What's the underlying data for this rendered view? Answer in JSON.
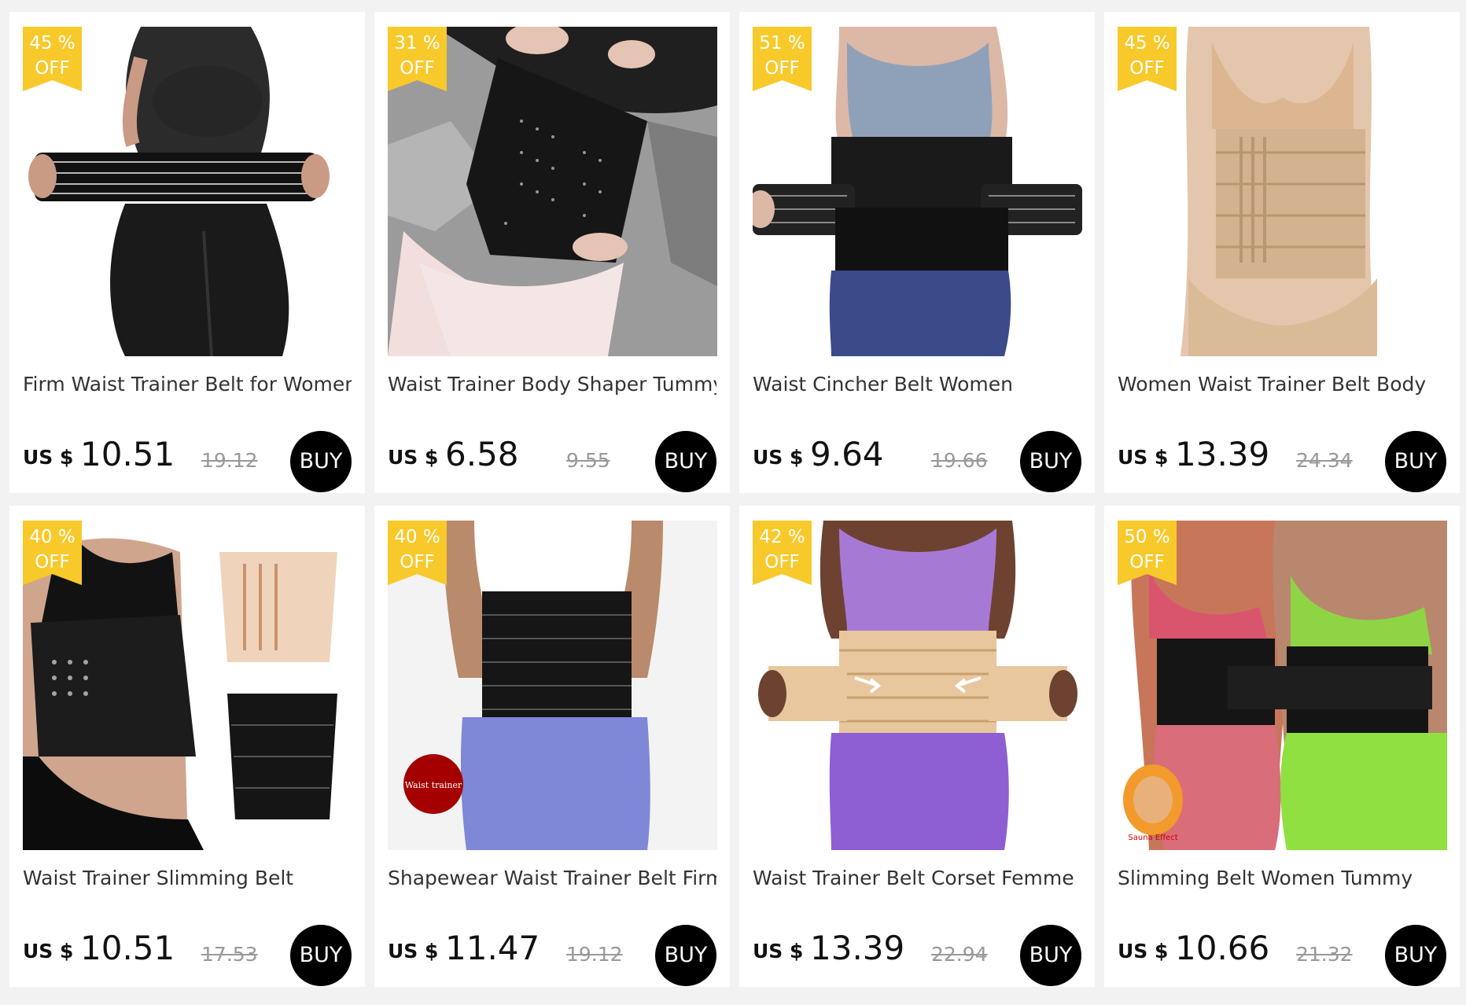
{
  "products": [
    {
      "discount": "45 %",
      "off": "OFF",
      "title": "Firm Waist Trainer Belt for Women",
      "currency": "US $",
      "price": "10.51",
      "old_price": "19.12",
      "buy": "BUY"
    },
    {
      "discount": "31 %",
      "off": "OFF",
      "title": "Waist Trainer Body Shaper Tummy",
      "currency": "US $",
      "price": "6.58",
      "old_price": "9.55",
      "buy": "BUY"
    },
    {
      "discount": "51 %",
      "off": "OFF",
      "title": "Waist Cincher Belt Women",
      "currency": "US $",
      "price": "9.64",
      "old_price": "19.66",
      "buy": "BUY"
    },
    {
      "discount": "45 %",
      "off": "OFF",
      "title": "Women Waist Trainer Belt Body",
      "currency": "US $",
      "price": "13.39",
      "old_price": "24.34",
      "buy": "BUY"
    },
    {
      "discount": "40 %",
      "off": "OFF",
      "title": "Waist Trainer Slimming Belt",
      "currency": "US $",
      "price": "10.51",
      "old_price": "17.53",
      "buy": "BUY"
    },
    {
      "discount": "40 %",
      "off": "OFF",
      "title": "Shapewear Waist Trainer Belt Firm",
      "currency": "US $",
      "price": "11.47",
      "old_price": "19.12",
      "buy": "BUY",
      "image_text": "Waist trainer"
    },
    {
      "discount": "42 %",
      "off": "OFF",
      "title": "Waist Trainer Belt Corset Femme",
      "currency": "US $",
      "price": "13.39",
      "old_price": "22.94",
      "buy": "BUY"
    },
    {
      "discount": "50 %",
      "off": "OFF",
      "title": "Slimming Belt Women Tummy",
      "currency": "US $",
      "price": "10.66",
      "old_price": "21.32",
      "buy": "BUY",
      "image_text": "Sauna Effect"
    }
  ],
  "colors": {
    "badge": "#f8c92b",
    "buy_button": "#000000",
    "page_bg": "#f2f2f2"
  }
}
